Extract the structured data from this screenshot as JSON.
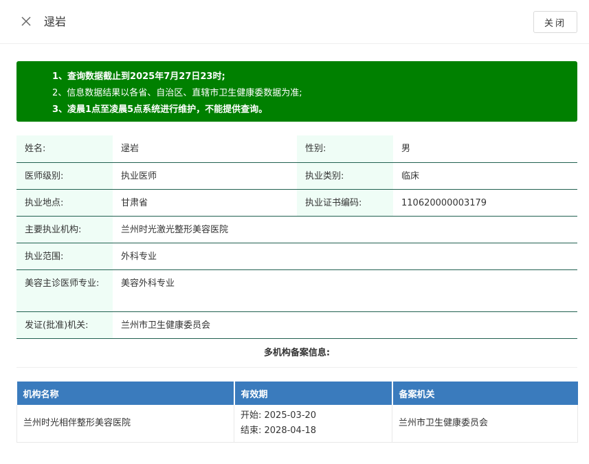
{
  "header": {
    "title": "逯岩",
    "close_label": "关闭"
  },
  "notice": {
    "line1": "1、查询数据截止到2025年7月27日23时;",
    "line2": "2、信息数据结果以各省、自治区、直辖市卫生健康委数据为准;",
    "line3": "3、凌晨1点至凌晨5点系统进行维护，不能提供查询。",
    "bg_color": "#008000"
  },
  "info": {
    "name_label": "姓名:",
    "name_value": "逯岩",
    "gender_label": "性别:",
    "gender_value": "男",
    "level_label": "医师级别:",
    "level_value": "执业医师",
    "type_label": "执业类别:",
    "type_value": "临床",
    "location_label": "执业地点:",
    "location_value": "甘肃省",
    "cert_label": "执业证书编码:",
    "cert_value": "110620000003179",
    "institution_label": "主要执业机构:",
    "institution_value": "兰州时光激光整形美容医院",
    "scope_label": "执业范围:",
    "scope_value": "外科专业",
    "cosmetic_label": "美容主诊医师专业:",
    "cosmetic_value": "美容外科专业",
    "issuer_label": "发证(批准)机关:",
    "issuer_value": "兰州市卫生健康委员会"
  },
  "multi": {
    "title": "多机构备案信息:",
    "headers": [
      "机构名称",
      "有效期",
      "备案机关"
    ],
    "rows": [
      {
        "org": "兰州时光相伴整形美容医院",
        "start": "开始: 2025-03-20",
        "end": "结束: 2028-04-18",
        "authority": "兰州市卫生健康委员会"
      }
    ],
    "header_color": "#3a7bbd"
  }
}
